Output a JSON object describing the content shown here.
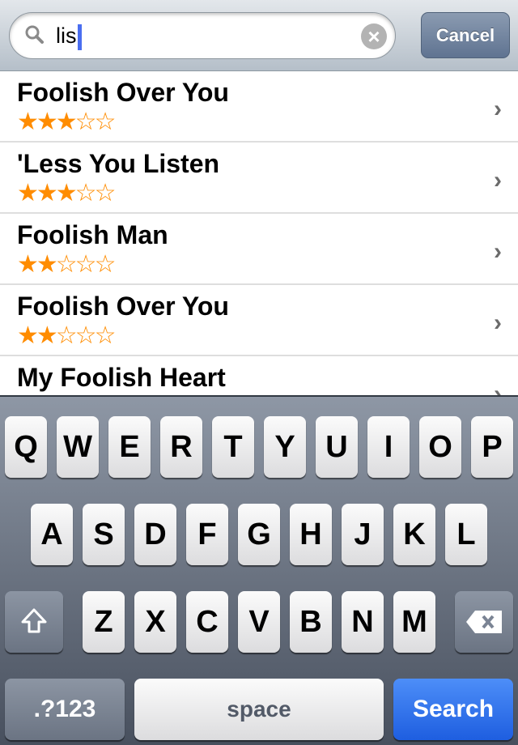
{
  "search": {
    "query": "lis",
    "cancel_label": "Cancel"
  },
  "results": [
    {
      "title": "Foolish Over You",
      "rating": 3
    },
    {
      "title": "'Less You Listen",
      "rating": 3
    },
    {
      "title": "Foolish Man",
      "rating": 2
    },
    {
      "title": "Foolish Over You",
      "rating": 2
    },
    {
      "title": "My Foolish Heart"
    }
  ],
  "rating_max": 5,
  "star_color": "#ff8c00",
  "keyboard": {
    "row1": [
      "Q",
      "W",
      "E",
      "R",
      "T",
      "Y",
      "U",
      "I",
      "O",
      "P"
    ],
    "row2": [
      "A",
      "S",
      "D",
      "F",
      "G",
      "H",
      "J",
      "K",
      "L"
    ],
    "row3": [
      "Z",
      "X",
      "C",
      "V",
      "B",
      "N",
      "M"
    ],
    "numbers_label": ".?123",
    "space_label": "space",
    "search_label": "Search"
  }
}
